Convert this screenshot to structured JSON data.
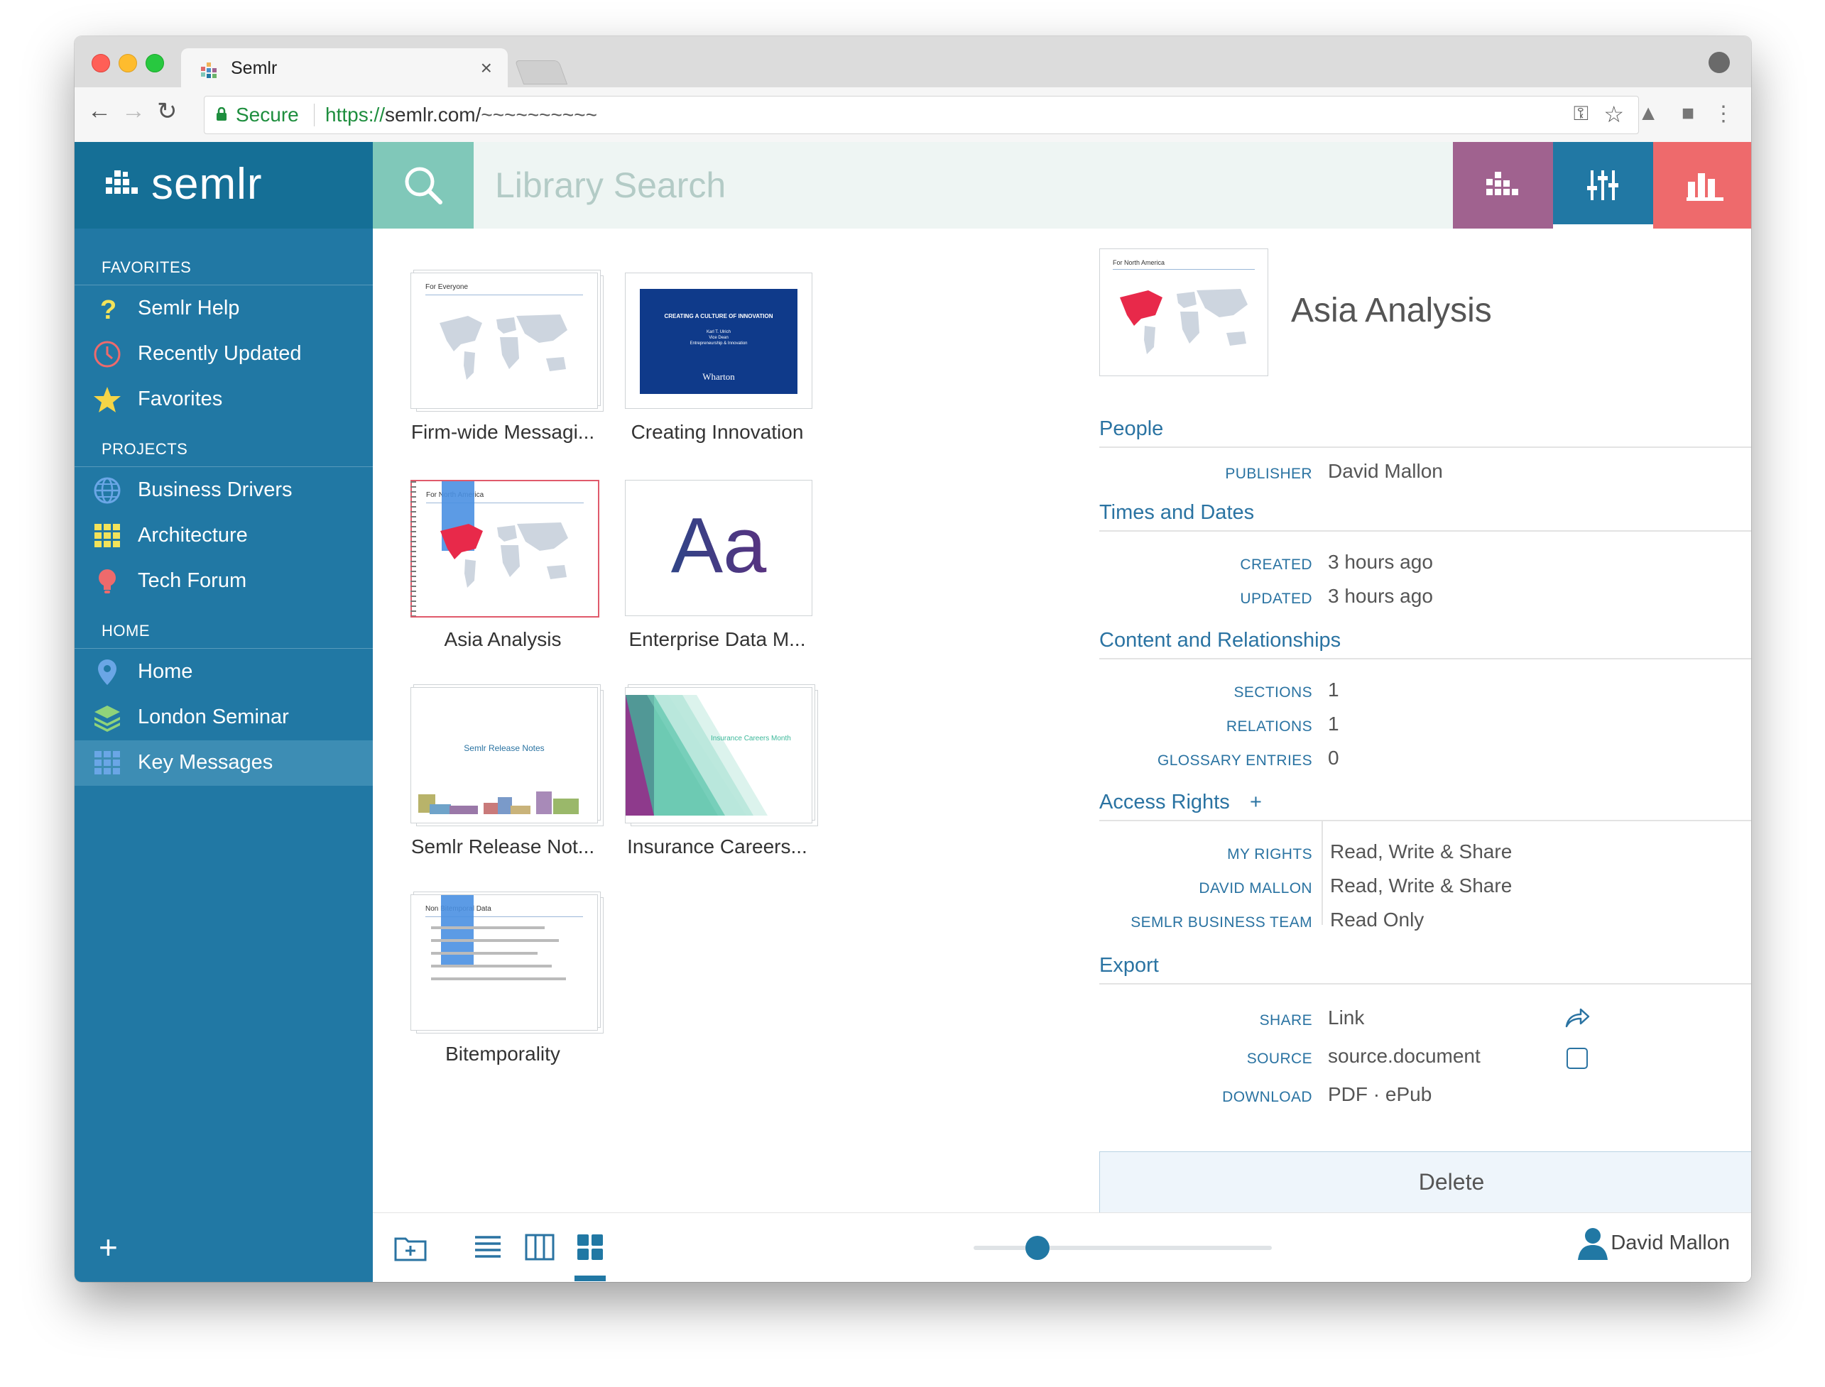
{
  "browser": {
    "tab_title": "Semlr",
    "secure_label": "Secure",
    "url_scheme": "https://",
    "url_host": "semlr.com/",
    "url_path": "~~~~~~~~~~"
  },
  "app": {
    "brand": "semlr",
    "search_placeholder": "Library Search",
    "colors": {
      "sidebar": "#2178a4",
      "brand_bg": "#156f96",
      "search_icon_bg": "#80c8b9",
      "btn_purple": "#a0628f",
      "btn_blue": "#2178a4",
      "btn_red": "#ee6a6c",
      "accent": "#2a73a2"
    }
  },
  "sidebar": {
    "favorites_header": "FAVORITES",
    "favorites": [
      {
        "label": "Semlr Help",
        "icon": "question-icon"
      },
      {
        "label": "Recently Updated",
        "icon": "clock-icon"
      },
      {
        "label": "Favorites",
        "icon": "star-icon"
      }
    ],
    "projects_header": "PROJECTS",
    "projects": [
      {
        "label": "Business Drivers",
        "icon": "globe-icon"
      },
      {
        "label": "Architecture",
        "icon": "grid-icon"
      },
      {
        "label": "Tech Forum",
        "icon": "lightbulb-icon"
      }
    ],
    "home_header": "HOME",
    "home": [
      {
        "label": "Home",
        "icon": "location-pin-icon"
      },
      {
        "label": "London Seminar",
        "icon": "layers-icon"
      },
      {
        "label": "Key Messages",
        "icon": "tiles-icon",
        "active": true
      }
    ]
  },
  "library": {
    "items": [
      {
        "caption": "Firm-wide Messagi...",
        "thumb_label": "For Everyone"
      },
      {
        "caption": "Creating Innovation",
        "thumb_label": "CREATING A CULTURE OF INNOVATION",
        "thumb_sub1": "Karl T. Ulrich",
        "thumb_sub2": "Vice Dean",
        "thumb_sub3": "Entrepreneurship & Innovation",
        "thumb_logo": "Wharton"
      },
      {
        "caption": "Asia Analysis",
        "thumb_label": "For North America",
        "selected": true
      },
      {
        "caption": "Enterprise Data M...",
        "thumb_label": "Aa"
      },
      {
        "caption": "Semlr Release Not...",
        "thumb_label": "Semlr Release Notes"
      },
      {
        "caption": "Insurance Careers...",
        "thumb_label": "Insurance Careers Month"
      },
      {
        "caption": "Bitemporality",
        "thumb_label": "Non Bitemporal Data"
      }
    ]
  },
  "detail": {
    "thumb_label": "For North America",
    "title": "Asia Analysis",
    "people": {
      "header": "People",
      "rows": [
        {
          "key": "PUBLISHER",
          "value": "David Mallon"
        }
      ]
    },
    "times": {
      "header": "Times and Dates",
      "rows": [
        {
          "key": "CREATED",
          "value": "3 hours ago"
        },
        {
          "key": "UPDATED",
          "value": "3 hours ago"
        }
      ]
    },
    "content": {
      "header": "Content and Relationships",
      "rows": [
        {
          "key": "SECTIONS",
          "value": "1"
        },
        {
          "key": "RELATIONS",
          "value": "1"
        },
        {
          "key": "GLOSSARY ENTRIES",
          "value": "0"
        }
      ]
    },
    "access": {
      "header": "Access Rights",
      "add": "+",
      "rows": [
        {
          "key": "MY RIGHTS",
          "value": "Read, Write & Share"
        },
        {
          "key": "DAVID MALLON",
          "value": "Read, Write & Share"
        },
        {
          "key": "SEMLR BUSINESS TEAM",
          "value": "Read Only"
        }
      ]
    },
    "export": {
      "header": "Export",
      "rows": [
        {
          "key": "SHARE",
          "value": "Link"
        },
        {
          "key": "SOURCE",
          "value": "source.document"
        },
        {
          "key": "DOWNLOAD",
          "value": "PDF · ePub"
        }
      ]
    },
    "delete_label": "Delete"
  },
  "footer": {
    "user_name": "David Mallon",
    "zoom_level": 0.19
  }
}
